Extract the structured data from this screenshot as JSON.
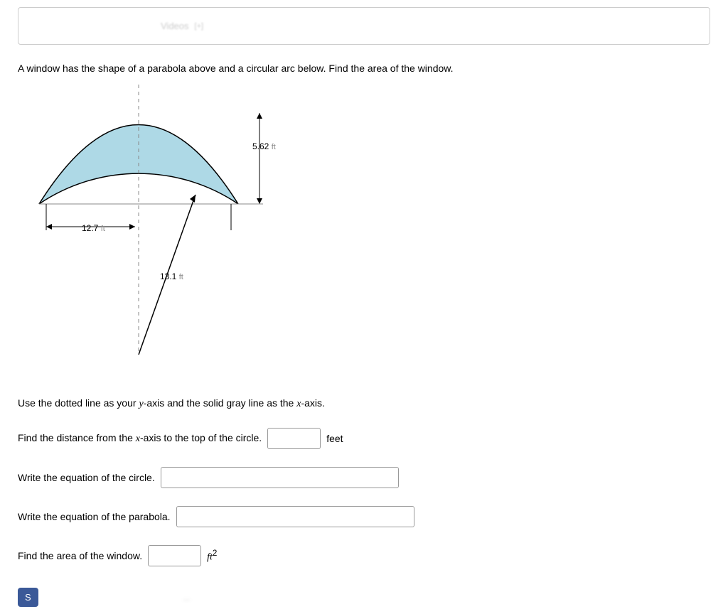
{
  "header": {
    "videos_label": "Videos",
    "external_icon": "[+]"
  },
  "problem": {
    "statement": "A window has the shape of a parabola above and a circular arc below. Find the area of the window.",
    "instruction_prefix": "Use the dotted line as your ",
    "instruction_y": "y",
    "instruction_mid": "-axis and the solid gray line as the ",
    "instruction_x": "x",
    "instruction_suffix": "-axis."
  },
  "dimensions": {
    "height": "5.62",
    "height_unit": "ft",
    "width": "12.7",
    "width_unit": "ft",
    "radius": "13.1",
    "radius_unit": "ft"
  },
  "questions": {
    "q1_prefix": "Find the distance from the ",
    "q1_x": "x",
    "q1_suffix": "-axis to the top of the circle.",
    "q1_unit": "feet",
    "q2": "Write the equation of the circle.",
    "q3": "Write the equation of the parabola.",
    "q4": "Find the area of the window.",
    "q4_unit_base": "ft",
    "q4_unit_exp": "2"
  },
  "submit": {
    "label": "S"
  }
}
